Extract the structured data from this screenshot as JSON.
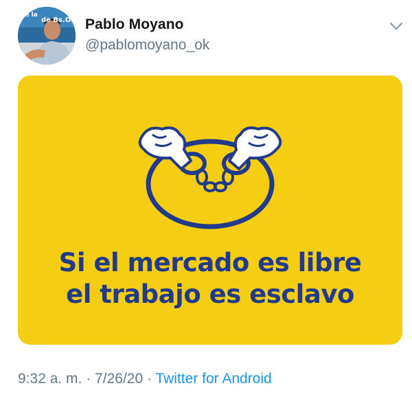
{
  "tweet": {
    "author": {
      "display_name": "Pablo Moyano",
      "handle": "@pablomoyano_ok",
      "avatar_icon": "profile-photo",
      "avatar_banner_text": "de Bs.Os"
    },
    "menu_icon": "chevron-down-icon",
    "media": {
      "background_color": "#f5ce14",
      "ink_color": "#223a8a",
      "illustration": "handcuffed-hands-icon",
      "slogan_line1": "Si el mercado es libre",
      "slogan_line2": "el trabajo es esclavo"
    },
    "meta": {
      "time": "9:32 a. m.",
      "separator": "·",
      "date": "7/26/20",
      "source": "Twitter for Android"
    },
    "colors": {
      "name": "#14171a",
      "secondary": "#657786",
      "link": "#1b95e0"
    }
  }
}
